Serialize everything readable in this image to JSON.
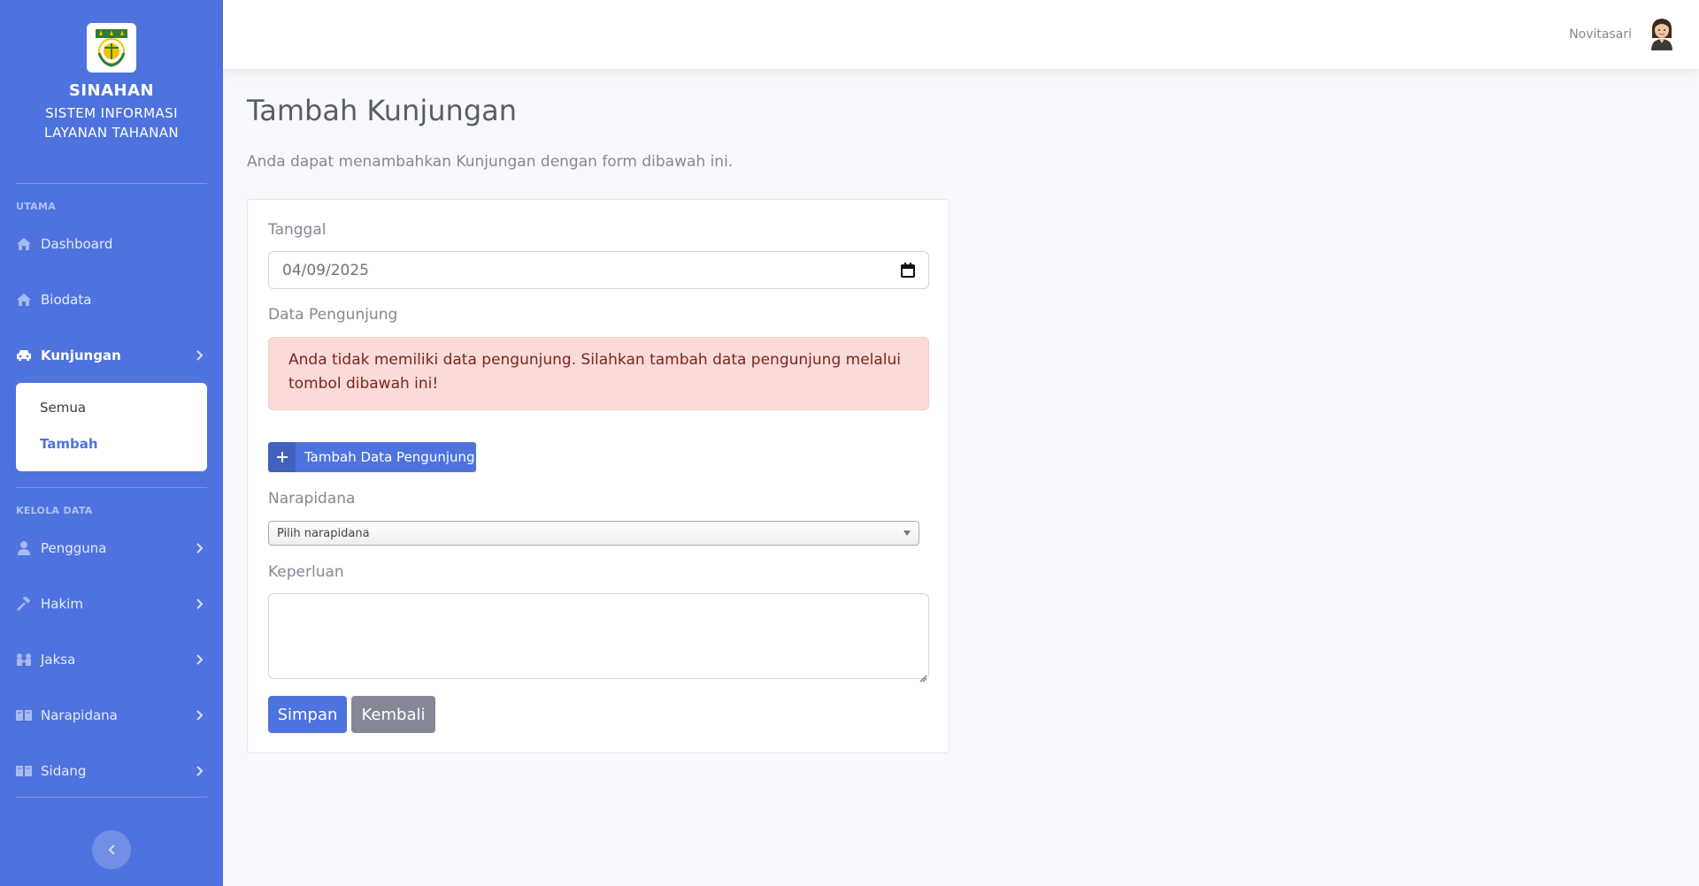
{
  "brand": {
    "logo_icon": "justice-scale-emblem-icon",
    "title": "SINAHAN",
    "subtitle_line1": "SISTEM INFORMASI",
    "subtitle_line2": "LAYANAN TAHANAN"
  },
  "sidebar": {
    "heading_main": "UTAMA",
    "heading_data": "KELOLA DATA",
    "items": [
      {
        "label": "Dashboard",
        "icon": "home-icon"
      },
      {
        "label": "Biodata",
        "icon": "home-icon"
      },
      {
        "label": "Kunjungan",
        "icon": "car-icon",
        "active": true
      },
      {
        "label": "Pengguna",
        "icon": "user-icon"
      },
      {
        "label": "Hakim",
        "icon": "gavel-icon"
      },
      {
        "label": "Jaksa",
        "icon": "users-icon"
      },
      {
        "label": "Narapidana",
        "icon": "book-icon"
      },
      {
        "label": "Sidang",
        "icon": "book-icon"
      }
    ],
    "submenu": [
      {
        "label": "Semua"
      },
      {
        "label": "Tambah",
        "active": true
      }
    ]
  },
  "topbar": {
    "user_name": "Novitasari"
  },
  "page": {
    "title": "Tambah Kunjungan",
    "description": "Anda dapat menambahkan Kunjungan dengan form dibawah ini."
  },
  "form": {
    "tanggal_label": "Tanggal",
    "tanggal_value": "04/09/2025",
    "pengunjung_label": "Data Pengunjung",
    "alert_text": "Anda tidak memiliki data pengunjung. Silahkan tambah data pengunjung melalui tombol dibawah ini!",
    "add_button_label": "Tambah Data Pengunjung",
    "narapidana_label": "Narapidana",
    "narapidana_placeholder": "Pilih narapidana",
    "keperluan_label": "Keperluan",
    "keperluan_value": "",
    "save_label": "Simpan",
    "back_label": "Kembali"
  },
  "colors": {
    "primary": "#4e73df",
    "secondary": "#858796",
    "alert_bg": "#fadbd8",
    "alert_text": "#78261f"
  }
}
